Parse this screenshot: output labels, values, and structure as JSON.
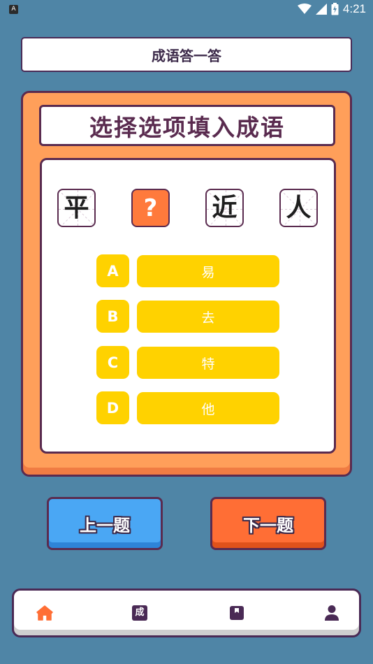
{
  "status_bar": {
    "app_icon": "A",
    "time": "4:21",
    "icons": [
      "wifi-icon",
      "signal-icon",
      "battery-icon"
    ]
  },
  "header": {
    "title": "成语答一答"
  },
  "card": {
    "title": "选择选项填入成语",
    "idiom_chars": [
      "平",
      "?",
      "近",
      "人"
    ],
    "options": [
      {
        "letter": "A",
        "text": "易"
      },
      {
        "letter": "B",
        "text": "去"
      },
      {
        "letter": "C",
        "text": "特"
      },
      {
        "letter": "D",
        "text": "他"
      }
    ]
  },
  "navigation": {
    "prev_label": "上一题",
    "next_label": "下一题"
  },
  "bottom_nav": {
    "tabs": [
      {
        "icon": "home-icon",
        "active": true,
        "color": "#ff6e35"
      },
      {
        "icon": "idiom-icon",
        "glyph": "成"
      },
      {
        "icon": "bookmark-icon"
      },
      {
        "icon": "profile-icon"
      }
    ]
  },
  "colors": {
    "background": "#4f85a6",
    "card": "#ff9f5a",
    "border": "#5a2b4f",
    "option": "#ffd200",
    "prev": "#4aa7f4",
    "next": "#ff6e35"
  }
}
